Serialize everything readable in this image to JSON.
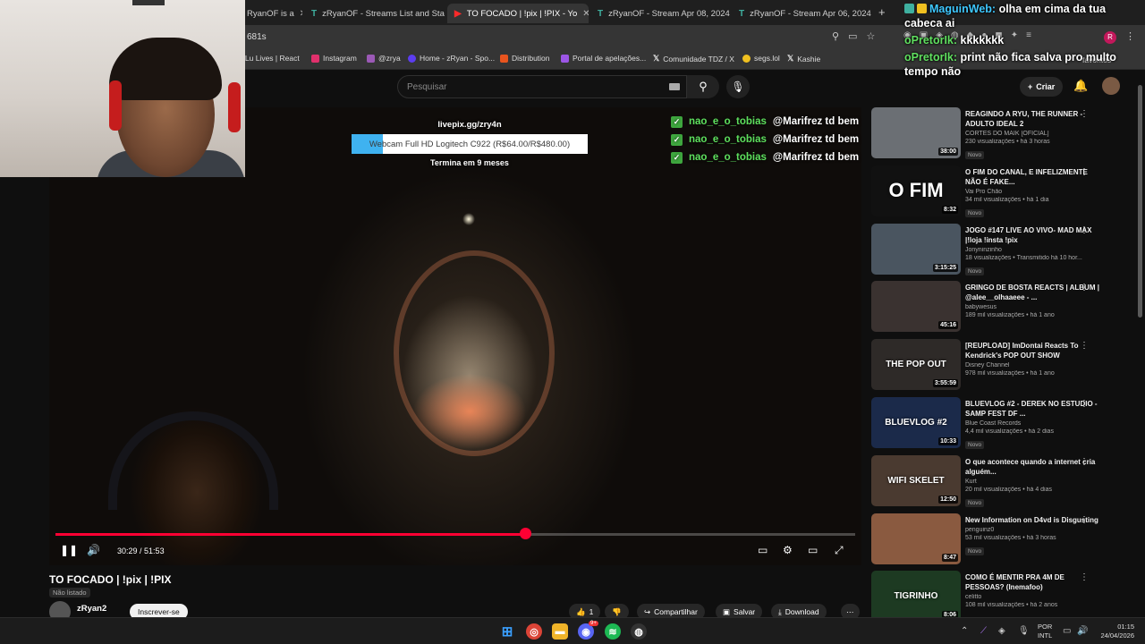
{
  "browser": {
    "tabs": [
      {
        "label": "RyanOF is a",
        "icon": "T"
      },
      {
        "label": "zRyanOF - Streams List and Sta",
        "icon": "T"
      },
      {
        "label": "TO FOCADO | !pix | !PIX - Yo",
        "icon": "▶",
        "active": true
      },
      {
        "label": "zRyanOF - Stream Apr 08, 2024",
        "icon": "T"
      },
      {
        "label": "zRyanOF - Stream Apr 06, 2024",
        "icon": "T"
      }
    ],
    "url": "681s",
    "bookmarks": [
      {
        "label": "iLu Lives | React",
        "color": "#888"
      },
      {
        "label": "Instagram",
        "color": "#e1306c"
      },
      {
        "label": "@zrya",
        "color": "#9b59b6"
      },
      {
        "label": "Home - zRyan - Spo...",
        "color": "#5c3df0"
      },
      {
        "label": "Distribution",
        "color": "#e8541e"
      },
      {
        "label": "Portal de apelações...",
        "color": "#9c56e6"
      },
      {
        "label": "Comunidade TDZ / X",
        "color": "#fff"
      },
      {
        "label": "segs.lol",
        "color": "#f0c020"
      },
      {
        "label": "Kashie",
        "color": "#fff"
      }
    ],
    "bookmarks_right": "favoritos"
  },
  "youtube": {
    "search_placeholder": "Pesquisar",
    "create_label": "Criar"
  },
  "overlay": {
    "livepix_url": "livepix.gg/zry4n",
    "goal_text": "Webcam Full HD Logitech C922 (R$64.00/R$480.00)",
    "goal_progress": 0.1333,
    "goal_ends": "Termina em 9 meses",
    "chat_in_video": [
      {
        "user": "nao_e_o_tobias",
        "text": "@Marifrez td bem"
      },
      {
        "user": "nao_e_o_tobias",
        "text": "@Marifrez td bem"
      },
      {
        "user": "nao_e_o_tobias",
        "text": "@Marifrez td bem"
      }
    ],
    "chat_top": [
      {
        "user": "MaguinWeb:",
        "text": "olha em cima da tua cabeca ai",
        "badges": true
      },
      {
        "user": "oPretorIk:",
        "text": "kkkkkkk"
      },
      {
        "user": "oPretorIk:",
        "text": "print não fica salva pro multo tempo não"
      }
    ]
  },
  "player": {
    "current_time": "30:29",
    "duration": "51:53",
    "progress": 0.5875
  },
  "video": {
    "title": "TO FOCADO | !pix | !PIX",
    "unlisted": "Não listado",
    "channel": "zRyan2",
    "subscribe": "Inscrever-se",
    "likes": "1",
    "share": "Compartilhar",
    "save": "Salvar",
    "download": "Download"
  },
  "recommendations": [
    {
      "title": "REAGINDO A RYU, THE RUNNER - ADULTO IDEAL 2",
      "channel": "CORTES DO MAIK [OFICIAL]",
      "meta": "230 visualizações • há 3 horas",
      "badge": "Novo",
      "duration": "38:00",
      "bg": "#6b6f74",
      "thumb_text": ""
    },
    {
      "title": "O FIM DO CANAL, E INFELIZMENTE NÃO É FAKE...",
      "channel": "Vai Pro Chão",
      "meta": "34 mil visualizações • há 1 dia",
      "badge": "Novo",
      "duration": "8:32",
      "bg": "#111111",
      "thumb_text": "O FIM"
    },
    {
      "title": "JOGO #147 LIVE AO VIVO- MAD MAX |!loja !insta !pix",
      "channel": "Jonyninzinho",
      "meta": "18 visualizações • Transmitido há 10 hor...",
      "badge": "Novo",
      "duration": "3:15:25",
      "bg": "#4a5560",
      "thumb_text": ""
    },
    {
      "title": "GRINGO DE BOSTA REACTS | ALBUM | @alee__olhaaeee - ...",
      "channel": "babywesus",
      "meta": "189 mil visualizações • há 1 ano",
      "badge": "",
      "duration": "45:16",
      "bg": "#3a3230",
      "thumb_text": ""
    },
    {
      "title": "[REUPLOAD] ImDontai Reacts To Kendrick's POP OUT SHOW",
      "channel": "Disney Channel",
      "meta": "978 mil visualizações • há 1 ano",
      "badge": "",
      "duration": "3:55:59",
      "bg": "#2e2a28",
      "thumb_text": "THE POP OUT"
    },
    {
      "title": "BLUEVLOG #2 - DEREK NO ESTUDIO - SAMP FEST DF ...",
      "channel": "Blue Coast Records",
      "meta": "4,4 mil visualizações • há 2 dias",
      "badge": "Novo",
      "duration": "10:33",
      "bg": "#1b2a4a",
      "thumb_text": "BLUEVLOG #2"
    },
    {
      "title": "O que acontece quando a internet cria alguém...",
      "channel": "Kurt",
      "meta": "20 mil visualizações • há 4 dias",
      "badge": "Novo",
      "duration": "12:50",
      "bg": "#4a3a30",
      "thumb_text": "WIFI SKELET"
    },
    {
      "title": "New Information on D4vd is Disgusting",
      "channel": "penguinz0",
      "meta": "53 mil visualizações • há 3 horas",
      "badge": "Novo",
      "duration": "8:47",
      "bg": "#8a5a40",
      "thumb_text": ""
    },
    {
      "title": "COMO É MENTIR PRA 4M DE PESSOAS? (Inemafoo)",
      "channel": "celitto",
      "meta": "108 mil visualizações • há 2 anos",
      "badge": "",
      "duration": "8:06",
      "bg": "#1d3a22",
      "thumb_text": "TIGRINHO"
    }
  ],
  "taskbar": {
    "lang_top": "POR",
    "lang_bottom": "INTL",
    "time": "01:15",
    "date": "24/04/2026",
    "discord_badge": "9+"
  },
  "colors": {
    "accent_red": "#ff0033",
    "chat_green": "#5ee05e",
    "goal_blue": "#3fb2f0"
  }
}
